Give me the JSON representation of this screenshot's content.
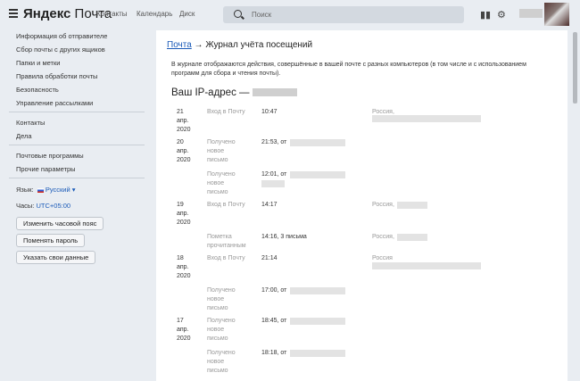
{
  "header": {
    "logo_brand": "Яндекс",
    "logo_product": "Почта",
    "nav": [
      "Контакты",
      "Календарь",
      "Диск"
    ],
    "search_placeholder": "Поиск"
  },
  "sidebar": {
    "group1": [
      "Информация об отправителе",
      "Сбор почты с других ящиков",
      "Папки и метки",
      "Правила обработки почты",
      "Безопасность",
      "Управление рассылками"
    ],
    "group2": [
      "Контакты",
      "Дела"
    ],
    "group3": [
      "Почтовые программы",
      "Прочие параметры"
    ],
    "language_label": "Язык:",
    "language_value": "Русский",
    "clock_label": "Часы:",
    "clock_value": "UTC+05:00",
    "buttons": [
      "Изменить часовой пояс",
      "Поменять пароль",
      "Указать свои данные"
    ]
  },
  "content": {
    "breadcrumb_link": "Почта",
    "breadcrumb_rest": " → Журнал учёта посещений",
    "description": "В журнале отображаются действия, совершённые в вашей почте с разных компьютеров (в том числе и с использованием программ для сбора и чтения почты).",
    "ip_title": "Ваш IP-адрес —",
    "entries": [
      {
        "date": [
          "21",
          "апр.",
          "2020"
        ],
        "type": [
          "Вход в Почту"
        ],
        "time": "10:47",
        "country": "Россия,"
      },
      {
        "date": [
          "20",
          "апр.",
          "2020"
        ],
        "type": [
          "Получено",
          "новое",
          "письмо"
        ],
        "time": "21:53, от",
        "country": ""
      },
      {
        "date": [],
        "type": [
          "Получено",
          "новое",
          "письмо"
        ],
        "time": "12:01, от",
        "country": ""
      },
      {
        "date": [
          "19",
          "апр.",
          "2020"
        ],
        "type": [
          "Вход в Почту"
        ],
        "time": "14:17",
        "country": "Россия,"
      },
      {
        "date": [],
        "type": [
          "Пометка",
          "прочитанным"
        ],
        "time": "14:16, 3 письма",
        "country": "Россия,"
      },
      {
        "date": [
          "18",
          "апр.",
          "2020"
        ],
        "type": [
          "Вход в Почту"
        ],
        "time": "21:14",
        "country": "Россия"
      },
      {
        "date": [],
        "type": [
          "Получено",
          "новое",
          "письмо"
        ],
        "time": "17:00, от",
        "country": ""
      },
      {
        "date": [
          "17",
          "апр.",
          "2020"
        ],
        "type": [
          "Получено",
          "новое",
          "письмо"
        ],
        "time": "18:45, от",
        "country": ""
      },
      {
        "date": [],
        "type": [
          "Получено",
          "новое",
          "письмо"
        ],
        "time": "18:18, от",
        "country": ""
      }
    ]
  },
  "colors": {
    "link": "#1a5ab8",
    "background": "#e9edf2"
  },
  "icons": [
    "menu-icon",
    "search-icon",
    "compose-icon",
    "settings-icon"
  ]
}
